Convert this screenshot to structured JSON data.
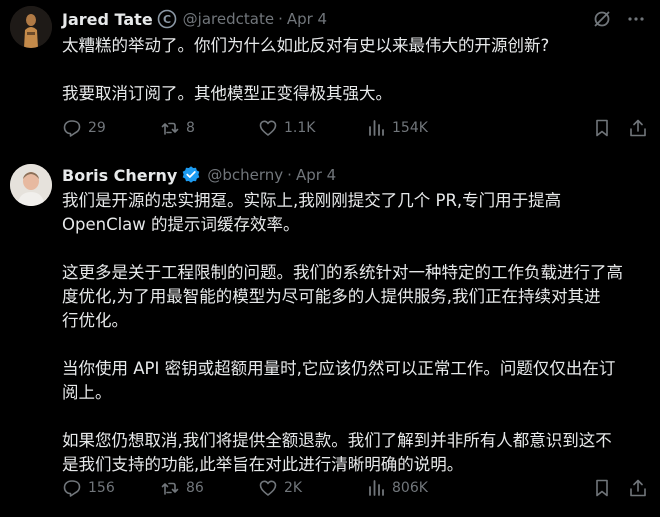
{
  "tweets": [
    {
      "author": {
        "name": "Jared Tate",
        "handle": "@jaredctate",
        "date": "Apr 4",
        "badge": "gray-check-icon"
      },
      "paragraphs": [
        "太糟糕的举动了。你们为什么如此反对有史以来最伟大的开源创新?",
        "我要取消订阅了。其他模型正变得极其强大。"
      ],
      "stats": {
        "replies": "29",
        "reposts": "8",
        "likes": "1.1K",
        "views": "154K"
      }
    },
    {
      "author": {
        "name": "Boris Cherny",
        "handle": "@bcherny",
        "date": "Apr 4",
        "badge": "blue-check-icon"
      },
      "paragraphs": [
        "我们是开源的忠实拥趸。实际上,我刚刚提交了几个 PR,专门用于提高\nOpenClaw 的提示词缓存效率。",
        "这更多是关于工程限制的问题。我们的系统针对一种特定的工作负载进行了高\n度优化,为了用最智能的模型为尽可能多的人提供服务,我们正在持续对其进\n行优化。",
        "当你使用 API 密钥或超额用量时,它应该仍然可以正常工作。问题仅仅出在订\n阅上。",
        "如果您仍想取消,我们将提供全额退款。我们了解到并非所有人都意识到这不\n是我们支持的功能,此举旨在对此进行清晰明确的说明。"
      ],
      "stats": {
        "replies": "156",
        "reposts": "86",
        "likes": "2K",
        "views": "806K"
      }
    }
  ],
  "colors": {
    "background": "#000000",
    "text": "#e7e9ea",
    "muted": "#71767b",
    "verified_blue": "#1d9bf0"
  }
}
